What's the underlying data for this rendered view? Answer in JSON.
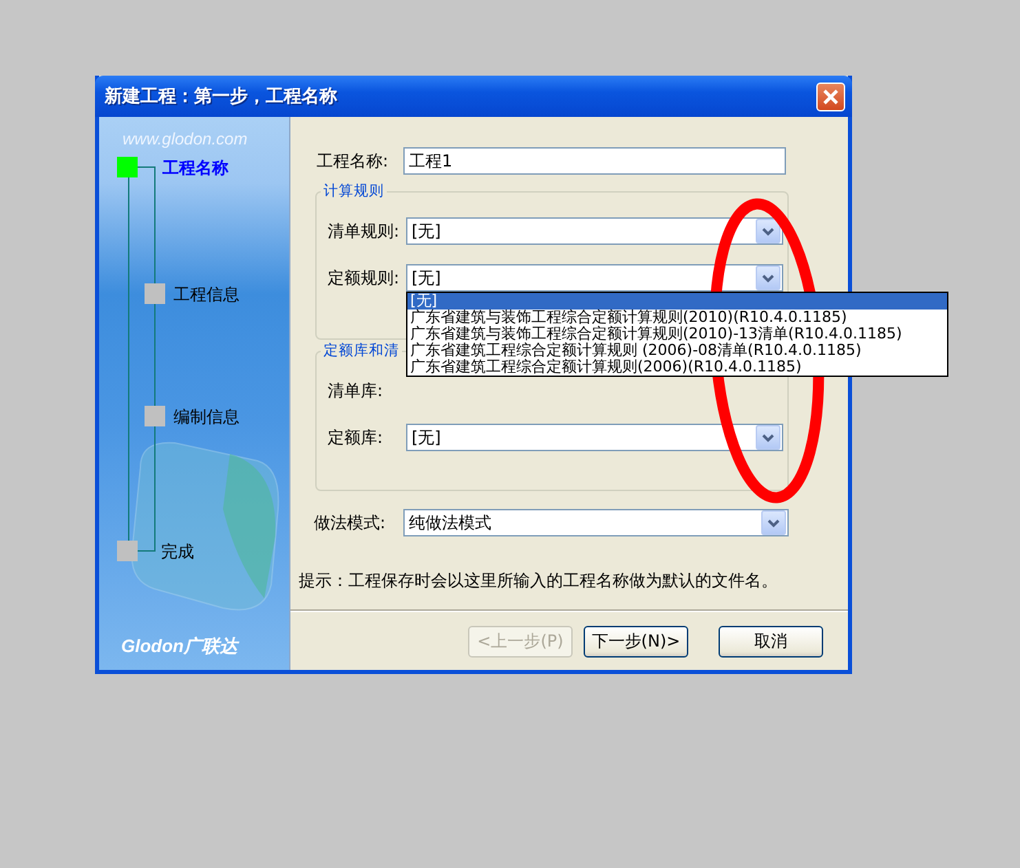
{
  "window": {
    "title": "新建工程：第一步，工程名称"
  },
  "sidebar": {
    "url": "www.glodon.com",
    "logo": "Glodon广联达",
    "steps": [
      {
        "label": "工程名称",
        "selected": true
      },
      {
        "label": "工程信息",
        "selected": false
      },
      {
        "label": "编制信息",
        "selected": false
      },
      {
        "label": "完成",
        "selected": false
      }
    ]
  },
  "form": {
    "name_field": {
      "label": "工程名称:",
      "value": "工程1"
    },
    "groups": [
      {
        "legend": "计算规则",
        "fields": [
          {
            "kind": "combo",
            "label": "清单规则:",
            "value": "[无]",
            "open": false
          },
          {
            "kind": "combo",
            "label": "定额规则:",
            "value": "[无]",
            "open": true,
            "options": [
              {
                "text": "[无]",
                "selected": true
              },
              {
                "text": "广东省建筑与装饰工程综合定额计算规则(2010)(R10.4.0.1185)",
                "selected": false
              },
              {
                "text": "广东省建筑与装饰工程综合定额计算规则(2010)-13清单(R10.4.0.1185)",
                "selected": false
              },
              {
                "text": "广东省建筑工程综合定额计算规则 (2006)-08清单(R10.4.0.1185)",
                "selected": false
              },
              {
                "text": "广东省建筑工程综合定额计算规则(2006)(R10.4.0.1185)",
                "selected": false
              }
            ]
          }
        ]
      },
      {
        "legend": "定额库和清",
        "fields": [
          {
            "kind": "covered",
            "label": "清单库:"
          },
          {
            "kind": "combo",
            "label": "定额库:",
            "value": "[无]",
            "open": false
          }
        ]
      }
    ],
    "mode_field": {
      "label": "做法模式:",
      "value": "纯做法模式"
    },
    "hint": "提示：工程保存时会以这里所输入的工程名称做为默认的文件名。"
  },
  "buttons": [
    {
      "label": "<上一步(P)",
      "disabled": true
    },
    {
      "label": "下一步(N)>",
      "disabled": false
    },
    {
      "label": "取消",
      "disabled": false
    }
  ],
  "annotation": {
    "kind": "ellipse"
  }
}
